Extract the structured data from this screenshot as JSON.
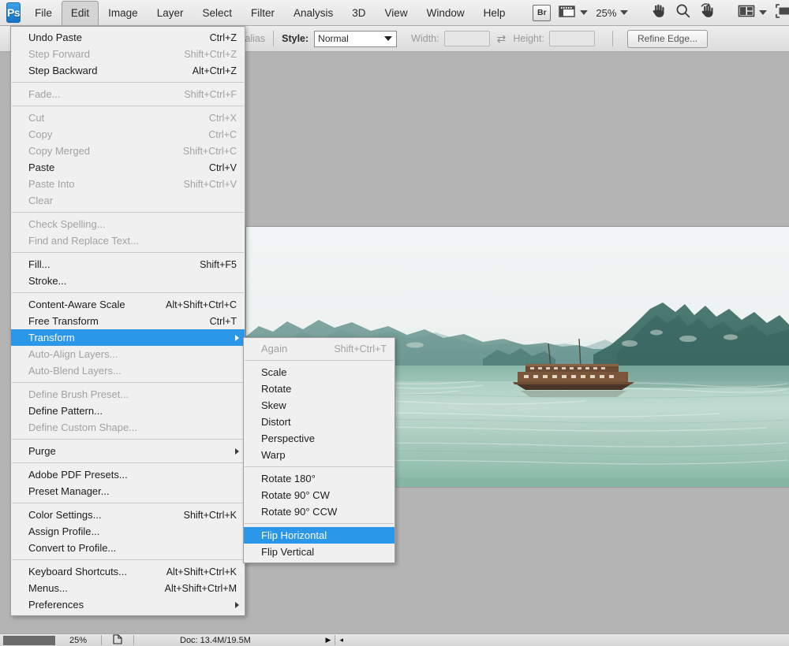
{
  "menubar": {
    "logo": "Ps",
    "items": [
      {
        "label": "File",
        "active": false
      },
      {
        "label": "Edit",
        "active": true
      },
      {
        "label": "Image",
        "active": false
      },
      {
        "label": "Layer",
        "active": false
      },
      {
        "label": "Select",
        "active": false
      },
      {
        "label": "Filter",
        "active": false
      },
      {
        "label": "Analysis",
        "active": false
      },
      {
        "label": "3D",
        "active": false
      },
      {
        "label": "View",
        "active": false
      },
      {
        "label": "Window",
        "active": false
      },
      {
        "label": "Help",
        "active": false
      }
    ],
    "bridge_label": "Br",
    "zoom_level": "25%",
    "icons": {
      "bridge": "bridge-icon",
      "view_extras": "view-extras-icon",
      "hand": "hand-tool-icon",
      "zoom": "zoom-tool-icon",
      "rotate_view": "rotate-view-tool-icon",
      "arrange_documents": "arrange-documents-icon",
      "screen_mode": "screen-mode-icon"
    }
  },
  "optionsbar": {
    "antialias_label": "ti-alias",
    "style_label": "Style:",
    "style_value": "Normal",
    "width_label": "Width:",
    "width_value": "",
    "height_label": "Height:",
    "height_value": "",
    "swap_icon": "swap-dimensions-icon",
    "refine_edge_label": "Refine Edge..."
  },
  "statusbar": {
    "zoom": "25%",
    "doc_info": "Doc: 13.4M/19.5M",
    "page_icon": "document-page-icon",
    "right_arrow": "▶",
    "left_arrow": "◂"
  },
  "document": {
    "title": "Ha Long Bay photograph",
    "alt": "Seascape with limestone karst mountains, calm green water and a wooden junk boat"
  },
  "edit_menu": {
    "groups": [
      {
        "items": [
          {
            "label": "Undo Paste",
            "shortcut": "Ctrl+Z",
            "disabled": false
          },
          {
            "label": "Step Forward",
            "shortcut": "Shift+Ctrl+Z",
            "disabled": true
          },
          {
            "label": "Step Backward",
            "shortcut": "Alt+Ctrl+Z",
            "disabled": false
          }
        ]
      },
      {
        "items": [
          {
            "label": "Fade...",
            "shortcut": "Shift+Ctrl+F",
            "disabled": true
          }
        ]
      },
      {
        "items": [
          {
            "label": "Cut",
            "shortcut": "Ctrl+X",
            "disabled": true
          },
          {
            "label": "Copy",
            "shortcut": "Ctrl+C",
            "disabled": true
          },
          {
            "label": "Copy Merged",
            "shortcut": "Shift+Ctrl+C",
            "disabled": true
          },
          {
            "label": "Paste",
            "shortcut": "Ctrl+V",
            "disabled": false
          },
          {
            "label": "Paste Into",
            "shortcut": "Shift+Ctrl+V",
            "disabled": true
          },
          {
            "label": "Clear",
            "shortcut": "",
            "disabled": true
          }
        ]
      },
      {
        "items": [
          {
            "label": "Check Spelling...",
            "shortcut": "",
            "disabled": true
          },
          {
            "label": "Find and Replace Text...",
            "shortcut": "",
            "disabled": true
          }
        ]
      },
      {
        "items": [
          {
            "label": "Fill...",
            "shortcut": "Shift+F5",
            "disabled": false
          },
          {
            "label": "Stroke...",
            "shortcut": "",
            "disabled": false
          }
        ]
      },
      {
        "items": [
          {
            "label": "Content-Aware Scale",
            "shortcut": "Alt+Shift+Ctrl+C",
            "disabled": false
          },
          {
            "label": "Free Transform",
            "shortcut": "Ctrl+T",
            "disabled": false
          },
          {
            "label": "Transform",
            "shortcut": "",
            "disabled": false,
            "selected": true,
            "submenu": true
          },
          {
            "label": "Auto-Align Layers...",
            "shortcut": "",
            "disabled": true
          },
          {
            "label": "Auto-Blend Layers...",
            "shortcut": "",
            "disabled": true
          }
        ]
      },
      {
        "items": [
          {
            "label": "Define Brush Preset...",
            "shortcut": "",
            "disabled": true
          },
          {
            "label": "Define Pattern...",
            "shortcut": "",
            "disabled": false
          },
          {
            "label": "Define Custom Shape...",
            "shortcut": "",
            "disabled": true
          }
        ]
      },
      {
        "items": [
          {
            "label": "Purge",
            "shortcut": "",
            "disabled": false,
            "submenu": true
          }
        ]
      },
      {
        "items": [
          {
            "label": "Adobe PDF Presets...",
            "shortcut": "",
            "disabled": false
          },
          {
            "label": "Preset Manager...",
            "shortcut": "",
            "disabled": false
          }
        ]
      },
      {
        "items": [
          {
            "label": "Color Settings...",
            "shortcut": "Shift+Ctrl+K",
            "disabled": false
          },
          {
            "label": "Assign Profile...",
            "shortcut": "",
            "disabled": false
          },
          {
            "label": "Convert to Profile...",
            "shortcut": "",
            "disabled": false
          }
        ]
      },
      {
        "items": [
          {
            "label": "Keyboard Shortcuts...",
            "shortcut": "Alt+Shift+Ctrl+K",
            "disabled": false
          },
          {
            "label": "Menus...",
            "shortcut": "Alt+Shift+Ctrl+M",
            "disabled": false
          },
          {
            "label": "Preferences",
            "shortcut": "",
            "disabled": false,
            "submenu": true
          }
        ]
      }
    ]
  },
  "transform_submenu": {
    "groups": [
      {
        "items": [
          {
            "label": "Again",
            "shortcut": "Shift+Ctrl+T",
            "disabled": true
          }
        ]
      },
      {
        "items": [
          {
            "label": "Scale",
            "shortcut": "",
            "disabled": false
          },
          {
            "label": "Rotate",
            "shortcut": "",
            "disabled": false
          },
          {
            "label": "Skew",
            "shortcut": "",
            "disabled": false
          },
          {
            "label": "Distort",
            "shortcut": "",
            "disabled": false
          },
          {
            "label": "Perspective",
            "shortcut": "",
            "disabled": false
          },
          {
            "label": "Warp",
            "shortcut": "",
            "disabled": false
          }
        ]
      },
      {
        "items": [
          {
            "label": "Rotate 180°",
            "shortcut": "",
            "disabled": false
          },
          {
            "label": "Rotate 90° CW",
            "shortcut": "",
            "disabled": false
          },
          {
            "label": "Rotate 90° CCW",
            "shortcut": "",
            "disabled": false
          }
        ]
      },
      {
        "items": [
          {
            "label": "Flip Horizontal",
            "shortcut": "",
            "disabled": false,
            "selected": true
          },
          {
            "label": "Flip Vertical",
            "shortcut": "",
            "disabled": false
          }
        ]
      }
    ]
  },
  "colors": {
    "highlight": "#2b97e8",
    "menu_bg": "#f0f0f0",
    "chrome_bg": "#e2e2e2",
    "canvas_bg": "#b4b4b4",
    "disabled_text": "#a2a2a2"
  }
}
